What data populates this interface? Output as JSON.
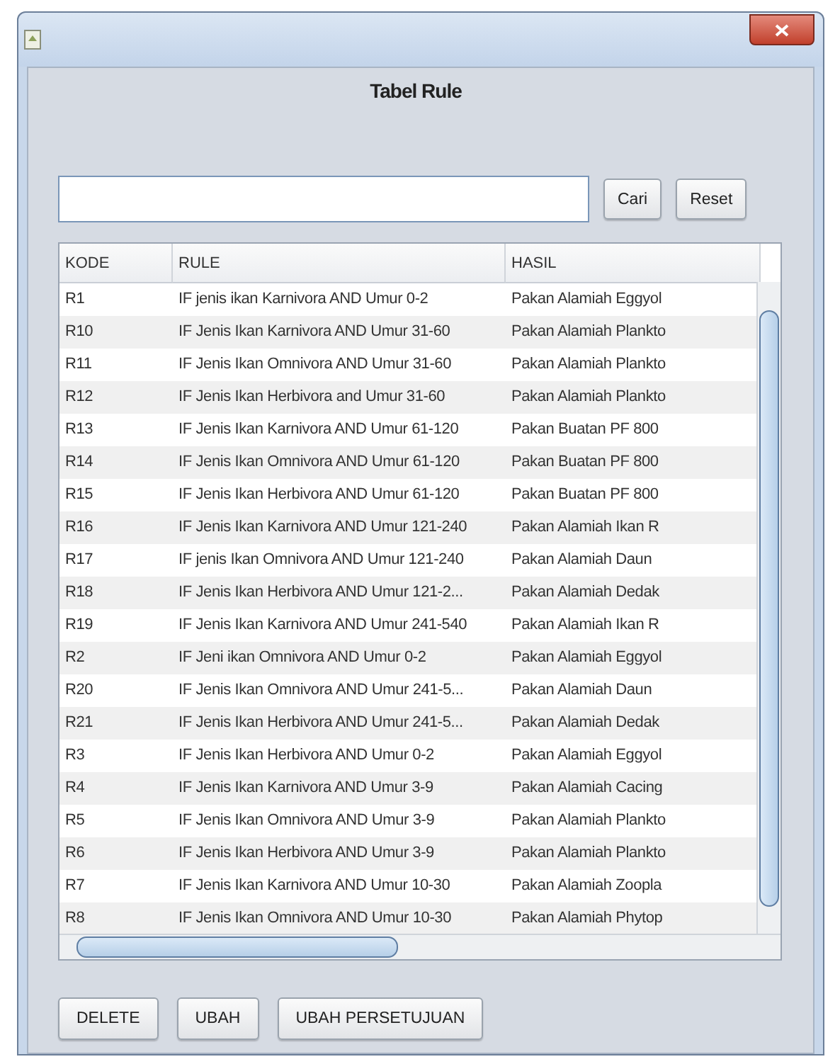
{
  "window": {
    "heading": "Tabel Rule"
  },
  "search_buttons": [
    "Cari",
    "Reset"
  ],
  "table": {
    "columns": [
      "KODE",
      "RULE",
      "HASIL"
    ],
    "rows": [
      {
        "kode": "R1",
        "rule": "IF jenis ikan Karnivora AND Umur 0-2",
        "hasil": "Pakan Alamiah Eggyol"
      },
      {
        "kode": "R10",
        "rule": "IF Jenis Ikan Karnivora AND Umur 31-60",
        "hasil": "Pakan Alamiah Plankto"
      },
      {
        "kode": "R11",
        "rule": "IF Jenis Ikan Omnivora AND Umur 31-60",
        "hasil": "Pakan Alamiah Plankto"
      },
      {
        "kode": "R12",
        "rule": "IF Jenis Ikan Herbivora and Umur 31-60",
        "hasil": "Pakan Alamiah Plankto"
      },
      {
        "kode": "R13",
        "rule": "IF Jenis Ikan Karnivora AND Umur 61-120",
        "hasil": "Pakan Buatan PF 800"
      },
      {
        "kode": "R14",
        "rule": "IF Jenis Ikan Omnivora AND Umur 61-120",
        "hasil": "Pakan Buatan PF 800"
      },
      {
        "kode": "R15",
        "rule": "IF Jenis Ikan Herbivora AND Umur 61-120",
        "hasil": "Pakan Buatan PF 800"
      },
      {
        "kode": "R16",
        "rule": "IF Jenis Ikan Karnivora AND Umur 121-240",
        "hasil": "Pakan Alamiah Ikan R"
      },
      {
        "kode": "R17",
        "rule": "IF jenis Ikan Omnivora AND Umur 121-240",
        "hasil": "Pakan Alamiah Daun"
      },
      {
        "kode": "R18",
        "rule": "IF Jenis Ikan Herbivora AND Umur 121-2...",
        "hasil": "Pakan Alamiah Dedak"
      },
      {
        "kode": "R19",
        "rule": "IF Jenis Ikan Karnivora AND Umur 241-540",
        "hasil": "Pakan Alamiah Ikan R"
      },
      {
        "kode": "R2",
        "rule": "IF Jeni ikan Omnivora AND Umur 0-2",
        "hasil": "Pakan Alamiah Eggyol"
      },
      {
        "kode": "R20",
        "rule": "IF Jenis Ikan Omnivora AND Umur 241-5...",
        "hasil": "Pakan Alamiah Daun"
      },
      {
        "kode": "R21",
        "rule": "IF Jenis Ikan Herbivora AND Umur 241-5...",
        "hasil": "Pakan Alamiah Dedak"
      },
      {
        "kode": "R3",
        "rule": "IF Jenis Ikan Herbivora AND Umur 0-2",
        "hasil": "Pakan Alamiah Eggyol"
      },
      {
        "kode": "R4",
        "rule": "IF Jenis Ikan Karnivora AND Umur 3-9",
        "hasil": "Pakan Alamiah Cacing"
      },
      {
        "kode": "R5",
        "rule": "IF Jenis Ikan Omnivora AND Umur 3-9",
        "hasil": "Pakan Alamiah Plankto"
      },
      {
        "kode": "R6",
        "rule": "IF Jenis Ikan Herbivora AND Umur 3-9",
        "hasil": "Pakan Alamiah Plankto"
      },
      {
        "kode": "R7",
        "rule": "IF Jenis Ikan Karnivora AND Umur 10-30",
        "hasil": "Pakan Alamiah Zoopla"
      },
      {
        "kode": "R8",
        "rule": "IF Jenis Ikan Omnivora AND Umur 10-30",
        "hasil": "Pakan Alamiah Phytop"
      }
    ]
  },
  "actions": [
    "DELETE",
    "UBAH",
    "UBAH PERSETUJUAN"
  ]
}
